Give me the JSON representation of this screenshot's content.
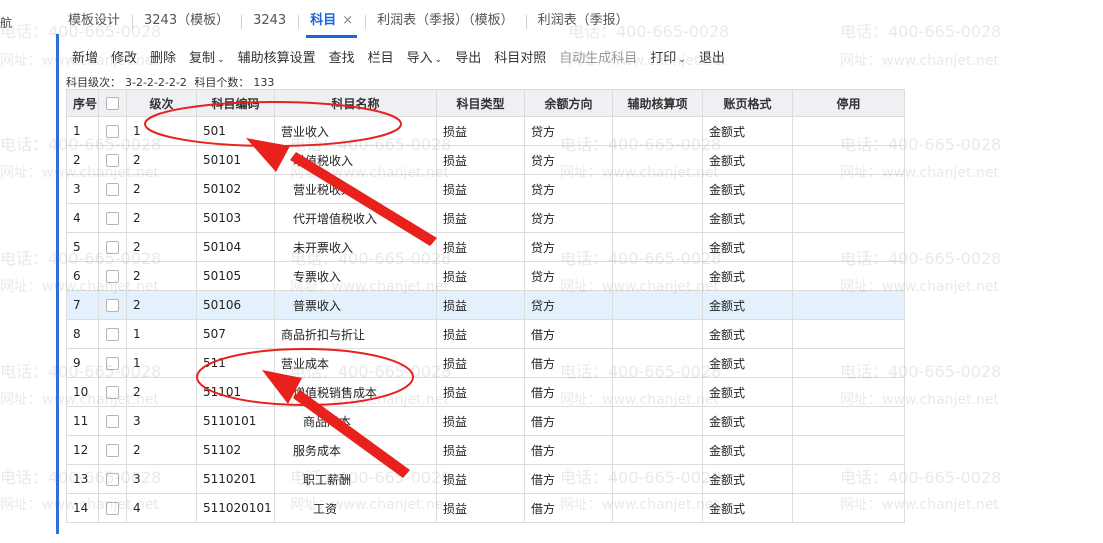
{
  "nav": {
    "label": "航"
  },
  "tabs": [
    {
      "label": "模板设计"
    },
    {
      "label": "3243（模板）"
    },
    {
      "label": "3243"
    },
    {
      "label": "科目",
      "close": "×"
    },
    {
      "label": "利润表（季报）（模板）"
    },
    {
      "label": "利润表（季报）"
    }
  ],
  "toolbar": {
    "items": [
      {
        "label": "新增"
      },
      {
        "label": "修改"
      },
      {
        "label": "删除"
      },
      {
        "label": "复制",
        "caret": "⌄"
      },
      {
        "label": "辅助核算设置"
      },
      {
        "label": "查找"
      },
      {
        "label": "栏目"
      },
      {
        "label": "导入",
        "caret": "⌄"
      },
      {
        "label": "导出"
      },
      {
        "label": "科目对照"
      },
      {
        "label": "自动生成科目"
      },
      {
        "label": "打印",
        "caret": "⌄"
      },
      {
        "label": "退出"
      }
    ]
  },
  "info": {
    "level_label": "科目级次：",
    "level_value": "3-2-2-2-2-2",
    "count_label": "科目个数：",
    "count_value": "133"
  },
  "table": {
    "headers": [
      "序号",
      "",
      "级次",
      "科目编码",
      "科目名称",
      "科目类型",
      "余额方向",
      "辅助核算项",
      "账页格式",
      "停用"
    ],
    "rows": [
      {
        "no": "1",
        "level": "1",
        "code": "501",
        "name": "营业收入",
        "type": "损益",
        "dir": "贷方",
        "aux": "",
        "format": "金额式",
        "disabled": ""
      },
      {
        "no": "2",
        "level": "2",
        "code": "50101",
        "name": "增值税收入",
        "type": "损益",
        "dir": "贷方",
        "aux": "",
        "format": "金额式",
        "disabled": ""
      },
      {
        "no": "3",
        "level": "2",
        "code": "50102",
        "name": "营业税收入",
        "type": "损益",
        "dir": "贷方",
        "aux": "",
        "format": "金额式",
        "disabled": ""
      },
      {
        "no": "4",
        "level": "2",
        "code": "50103",
        "name": "代开增值税收入",
        "type": "损益",
        "dir": "贷方",
        "aux": "",
        "format": "金额式",
        "disabled": ""
      },
      {
        "no": "5",
        "level": "2",
        "code": "50104",
        "name": "未开票收入",
        "type": "损益",
        "dir": "贷方",
        "aux": "",
        "format": "金额式",
        "disabled": ""
      },
      {
        "no": "6",
        "level": "2",
        "code": "50105",
        "name": "专票收入",
        "type": "损益",
        "dir": "贷方",
        "aux": "",
        "format": "金额式",
        "disabled": ""
      },
      {
        "no": "7",
        "level": "2",
        "code": "50106",
        "name": "普票收入",
        "type": "损益",
        "dir": "贷方",
        "aux": "",
        "format": "金额式",
        "disabled": ""
      },
      {
        "no": "8",
        "level": "1",
        "code": "507",
        "name": "商品折扣与折让",
        "type": "损益",
        "dir": "借方",
        "aux": "",
        "format": "金额式",
        "disabled": ""
      },
      {
        "no": "9",
        "level": "1",
        "code": "511",
        "name": "营业成本",
        "type": "损益",
        "dir": "借方",
        "aux": "",
        "format": "金额式",
        "disabled": ""
      },
      {
        "no": "10",
        "level": "2",
        "code": "51101",
        "name": "增值税销售成本",
        "type": "损益",
        "dir": "借方",
        "aux": "",
        "format": "金额式",
        "disabled": ""
      },
      {
        "no": "11",
        "level": "3",
        "code": "5110101",
        "name": "商品成本",
        "type": "损益",
        "dir": "借方",
        "aux": "",
        "format": "金额式",
        "disabled": ""
      },
      {
        "no": "12",
        "level": "2",
        "code": "51102",
        "name": "服务成本",
        "type": "损益",
        "dir": "借方",
        "aux": "",
        "format": "金额式",
        "disabled": ""
      },
      {
        "no": "13",
        "level": "3",
        "code": "5110201",
        "name": "职工薪酬",
        "type": "损益",
        "dir": "借方",
        "aux": "",
        "format": "金额式",
        "disabled": ""
      },
      {
        "no": "14",
        "level": "4",
        "code": "511020101",
        "name": "工资",
        "type": "损益",
        "dir": "借方",
        "aux": "",
        "format": "金额式",
        "disabled": ""
      }
    ]
  },
  "watermark": {
    "phone": "电话：400-665-0028",
    "url": "网址：www.chanjet.net"
  },
  "colors": {
    "accent": "#1d64d6",
    "annotation": "#e8211c",
    "selected_row": "#e4f0fc"
  }
}
